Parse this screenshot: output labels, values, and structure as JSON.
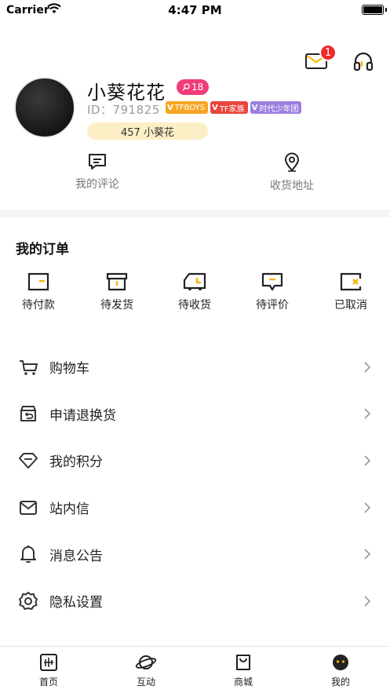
{
  "status_bar": {
    "carrier": "Carrier",
    "time": "4:47 PM"
  },
  "header": {
    "mail_badge": "1"
  },
  "profile": {
    "name": "小葵花花",
    "level": "18",
    "uid_label": "ID：791825",
    "tags": [
      {
        "text": "TFBOYS",
        "color": "#f6a623"
      },
      {
        "text": "TF家族",
        "color": "#e8453c"
      },
      {
        "text": "时代少年团",
        "color": "#9b7fe0"
      }
    ],
    "tag_mark": "V",
    "flower_count": "457 小葵花"
  },
  "quick_links": [
    {
      "label": "我的评论",
      "icon": "comment-icon"
    },
    {
      "label": "收货地址",
      "icon": "location-pin-icon"
    }
  ],
  "orders": {
    "title": "我的订单",
    "items": [
      {
        "label": "待付款",
        "icon": "wallet-icon"
      },
      {
        "label": "待发货",
        "icon": "box-icon"
      },
      {
        "label": "待收货",
        "icon": "truck-icon"
      },
      {
        "label": "待评价",
        "icon": "review-icon"
      },
      {
        "label": "已取消",
        "icon": "cancel-icon"
      }
    ]
  },
  "menu": [
    {
      "label": "购物车",
      "icon": "cart-icon"
    },
    {
      "label": "申请退换货",
      "icon": "return-icon"
    },
    {
      "label": "我的积分",
      "icon": "diamond-icon"
    },
    {
      "label": "站内信",
      "icon": "envelope-icon"
    },
    {
      "label": "消息公告",
      "icon": "bell-icon"
    },
    {
      "label": "隐私设置",
      "icon": "gear-icon"
    }
  ],
  "tabs": [
    {
      "label": "首页",
      "icon": "home-icon"
    },
    {
      "label": "互动",
      "icon": "planet-icon"
    },
    {
      "label": "商城",
      "icon": "shopping-bag-icon"
    },
    {
      "label": "我的",
      "icon": "profile-face-icon",
      "active": true
    }
  ],
  "colors": {
    "accent": "#f5b800",
    "badge_red": "#ee2b2b",
    "level_pink": "#f03d7a",
    "pill_bg": "#fcefc6"
  }
}
